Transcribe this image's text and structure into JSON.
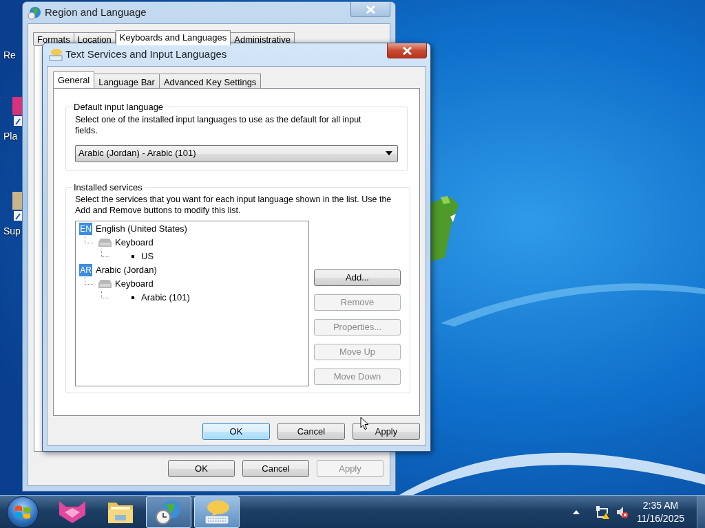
{
  "desktop": {
    "icons": [
      {
        "label": "Re"
      },
      {
        "label": "Pla"
      },
      {
        "label": "Sup"
      }
    ]
  },
  "region_window": {
    "title": "Region and Language",
    "tabs": [
      {
        "label": "Formats",
        "selected": false
      },
      {
        "label": "Location",
        "selected": false
      },
      {
        "label": "Keyboards and Languages",
        "selected": true
      },
      {
        "label": "Administrative",
        "selected": false
      }
    ],
    "buttons": [
      {
        "label": "OK",
        "disabled": false,
        "default": false
      },
      {
        "label": "Cancel",
        "disabled": false,
        "default": false
      },
      {
        "label": "Apply",
        "disabled": true,
        "default": false
      }
    ]
  },
  "text_services_window": {
    "title": "Text Services and Input Languages",
    "tabs": [
      {
        "label": "General",
        "selected": true
      },
      {
        "label": "Language Bar",
        "selected": false
      },
      {
        "label": "Advanced Key Settings",
        "selected": false
      }
    ],
    "default_input_language": {
      "heading": "Default input language",
      "description": "Select one of the installed input languages to use as the default for all input fields.",
      "dropdown_value": "Arabic (Jordan) - Arabic (101)"
    },
    "installed_services": {
      "heading": "Installed services",
      "description": "Select the services that you want for each input language shown in the list. Use the Add and Remove buttons to modify this list.",
      "tree": [
        {
          "badge": "EN",
          "label": "English (United States)",
          "children": [
            {
              "label": "Keyboard",
              "children": [
                {
                  "label": "US"
                }
              ]
            }
          ]
        },
        {
          "badge": "AR",
          "label": "Arabic (Jordan)",
          "children": [
            {
              "label": "Keyboard",
              "children": [
                {
                  "label": "Arabic (101)"
                }
              ]
            }
          ]
        }
      ],
      "buttons": [
        {
          "label": "Add...",
          "disabled": false
        },
        {
          "label": "Remove",
          "disabled": true
        },
        {
          "label": "Properties...",
          "disabled": true
        },
        {
          "label": "Move Up",
          "disabled": true
        },
        {
          "label": "Move Down",
          "disabled": true
        }
      ]
    },
    "buttons": [
      {
        "label": "OK",
        "disabled": false,
        "default": true
      },
      {
        "label": "Cancel",
        "disabled": false,
        "default": false
      },
      {
        "label": "Apply",
        "disabled": false,
        "default": false
      }
    ]
  },
  "taskbar": {
    "items": [
      {
        "running": false,
        "selected": false
      },
      {
        "running": false,
        "selected": false
      },
      {
        "running": true,
        "selected": false
      },
      {
        "running": true,
        "selected": true
      }
    ],
    "clock": {
      "time": "2:35 AM",
      "date": "11/16/2025"
    }
  }
}
